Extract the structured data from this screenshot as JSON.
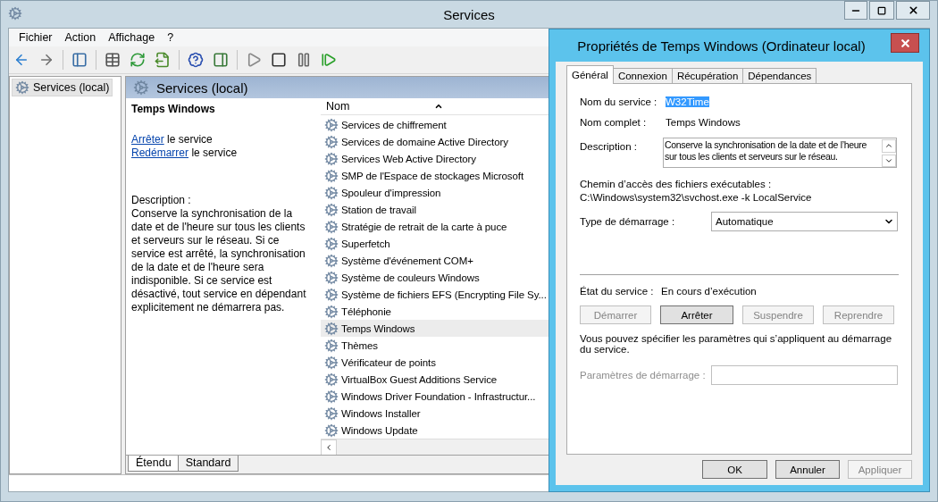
{
  "window": {
    "title": "Services"
  },
  "menu": [
    "Fichier",
    "Action",
    "Affichage",
    "?"
  ],
  "tree": [
    {
      "label": "Services (local)",
      "selected": true
    }
  ],
  "panel": {
    "header": "Services (local)",
    "service_name": "Temps Windows",
    "actions": [
      {
        "link": "Arrêter",
        "rest": "le service"
      },
      {
        "link": "Redémarrer",
        "rest": "le service"
      }
    ],
    "description_label": "Description :",
    "description": "Conserve la synchronisation de la date et de l'heure sur tous les clients et serveurs sur le réseau. Si ce service est arrêté, la synchronisation de la date et de l'heure sera indisponible. Si ce service est désactivé, tout service en dépendant explicitement ne démarrera pas."
  },
  "list": {
    "column_1": "Nom",
    "rows": [
      {
        "name": "Services de chiffrement",
        "selected": false
      },
      {
        "name": "Services de domaine Active Directory",
        "selected": false
      },
      {
        "name": "Services Web Active Directory",
        "selected": false
      },
      {
        "name": "SMP de l'Espace de stockages Microsoft",
        "selected": false
      },
      {
        "name": "Spouleur d'impression",
        "selected": false
      },
      {
        "name": "Station de travail",
        "selected": false
      },
      {
        "name": "Stratégie de retrait de la carte à puce",
        "selected": false
      },
      {
        "name": "Superfetch",
        "selected": false
      },
      {
        "name": "Système d'événement COM+",
        "selected": false
      },
      {
        "name": "Système de couleurs Windows",
        "selected": false
      },
      {
        "name": "Système de fichiers EFS (Encrypting File Sy...",
        "selected": false
      },
      {
        "name": "Téléphonie",
        "selected": false
      },
      {
        "name": "Temps Windows",
        "selected": true
      },
      {
        "name": "Thèmes",
        "selected": false
      },
      {
        "name": "Vérificateur de points",
        "selected": false
      },
      {
        "name": "VirtualBox Guest Additions Service",
        "selected": false
      },
      {
        "name": "Windows Driver Foundation - Infrastructur...",
        "selected": false
      },
      {
        "name": "Windows Installer",
        "selected": false
      },
      {
        "name": "Windows Update",
        "selected": false
      }
    ]
  },
  "view_tabs": [
    {
      "label": "Étendu",
      "selected": true
    },
    {
      "label": "Standard",
      "selected": false
    }
  ],
  "dialog": {
    "title": "Propriétés de Temps Windows (Ordinateur local)",
    "tabs": [
      {
        "label": "Général",
        "selected": true
      },
      {
        "label": "Connexion",
        "selected": false
      },
      {
        "label": "Récupération",
        "selected": false
      },
      {
        "label": "Dépendances",
        "selected": false
      }
    ],
    "service_name_label": "Nom du service :",
    "service_name": "W32Time",
    "service_name_selected": true,
    "display_name_label": "Nom complet :",
    "display_name": "Temps Windows",
    "description_label": "Description :",
    "description": "Conserve la synchronisation de la date et de l’heure sur tous les clients et serveurs sur le réseau.",
    "path_label": "Chemin d’accès des fichiers exécutables :",
    "path": "C:\\Windows\\system32\\svchost.exe -k LocalService",
    "startup_label": "Type de démarrage :",
    "startup_value": "Automatique",
    "status_label": "État du service :",
    "status": "En cours d’exécution",
    "control_buttons": [
      {
        "label": "Démarrer",
        "disabled": true
      },
      {
        "label": "Arrêter",
        "disabled": false
      },
      {
        "label": "Suspendre",
        "disabled": true
      },
      {
        "label": "Reprendre",
        "disabled": true
      }
    ],
    "hint": "Vous pouvez spécifier les paramètres qui s’appliquent au démarrage du service.",
    "params_label": "Paramètres de démarrage :",
    "params_disabled": true,
    "footer_buttons": [
      {
        "label": "OK",
        "disabled": false
      },
      {
        "label": "Annuler",
        "disabled": false
      },
      {
        "label": "Appliquer",
        "disabled": true
      }
    ]
  }
}
